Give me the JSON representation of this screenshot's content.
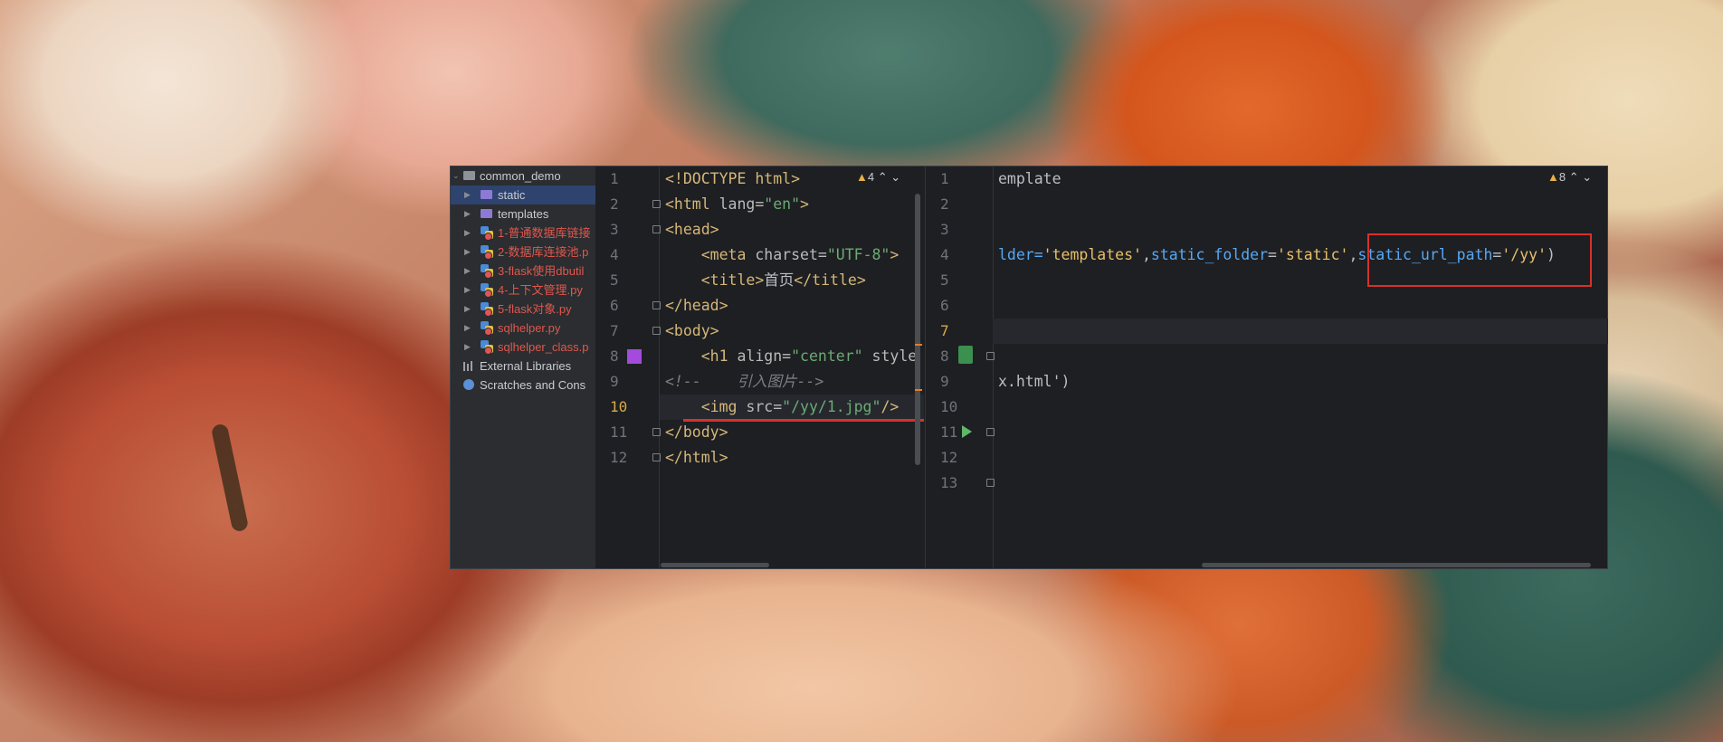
{
  "project": {
    "root": "common_demo",
    "items": [
      {
        "label": "static",
        "type": "folder"
      },
      {
        "label": "templates",
        "type": "folder"
      },
      {
        "label": "1-普通数据库链接",
        "type": "py"
      },
      {
        "label": "2-数据库连接池.p",
        "type": "py"
      },
      {
        "label": "3-flask使用dbutil",
        "type": "py"
      },
      {
        "label": "4-上下文管理.py",
        "type": "py"
      },
      {
        "label": "5-flask对象.py",
        "type": "py"
      },
      {
        "label": "sqlhelper.py",
        "type": "py"
      },
      {
        "label": "sqlhelper_class.p",
        "type": "py"
      }
    ],
    "external_libraries": "External Libraries",
    "scratches": "Scratches and Cons"
  },
  "left_editor": {
    "warnings": "4",
    "line_numbers": [
      "1",
      "2",
      "3",
      "4",
      "5",
      "6",
      "7",
      "8",
      "9",
      "10",
      "11",
      "12"
    ],
    "lines": {
      "l1": "<!DOCTYPE html>",
      "l2a": "<html ",
      "l2b": "lang=",
      "l2c": "\"en\"",
      "l2d": ">",
      "l3": "<head>",
      "l4a": "    <meta ",
      "l4b": "charset=",
      "l4c": "\"UTF-8\"",
      "l4d": ">",
      "l5a": "    <title>",
      "l5b": "首页",
      "l5c": "</title>",
      "l6": "</head>",
      "l7": "<body>",
      "l8a": "    <h1 ",
      "l8b": "align=",
      "l8c": "\"center\"",
      "l8d": " style",
      "l9": "<!--    引入图片-->",
      "l10a": "    <img ",
      "l10b": "src=",
      "l10c": "\"/yy/1.jpg\"",
      "l10d": "/>",
      "l11": "</body>",
      "l12": "</html>"
    }
  },
  "right_editor": {
    "warnings": "8",
    "line_numbers": [
      "1",
      "2",
      "3",
      "4",
      "5",
      "6",
      "7",
      "8",
      "9",
      "10",
      "11",
      "12",
      "13"
    ],
    "lines": {
      "l1": "emplate",
      "l4a": "lder=",
      "l4b": "'templates'",
      "l4c": ",",
      "l4d": "static_folder",
      "l4e": "=",
      "l4f": "'static'",
      "l4g": ",",
      "l4h": "static_url_path",
      "l4i": "=",
      "l4j": "'/yy'",
      "l4k": ")",
      "l9": "x.html')"
    }
  },
  "colors": {
    "annotation_red": "#d9312b",
    "tag": "#d5b778",
    "string": "#6aab73",
    "param": "#56a8f5"
  }
}
